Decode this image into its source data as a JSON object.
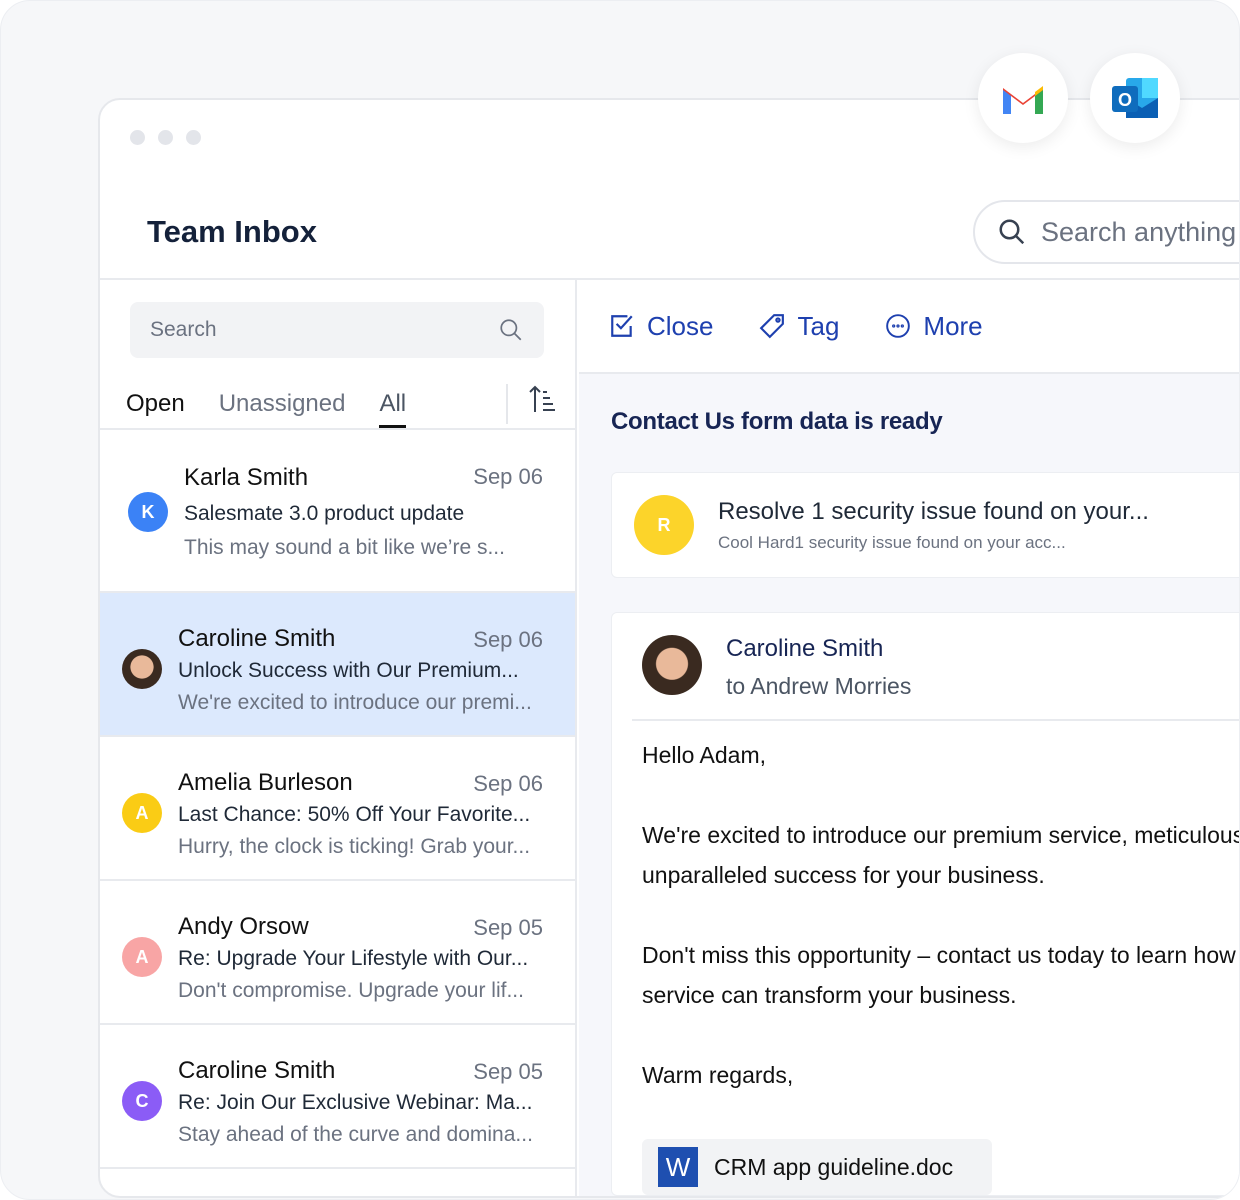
{
  "window": {
    "title": "Team Inbox"
  },
  "integrations": [
    {
      "name": "Gmail",
      "icon": "gmail-icon"
    },
    {
      "name": "Outlook",
      "icon": "outlook-icon"
    }
  ],
  "global_search": {
    "placeholder": "Search anything"
  },
  "inbox": {
    "search_placeholder": "Search",
    "tabs": [
      {
        "label": "Open"
      },
      {
        "label": "Unassigned"
      },
      {
        "label": "All",
        "selected": true
      }
    ],
    "items": [
      {
        "name": "Karla Smith",
        "date": "Sep 06",
        "subject": "Salesmate 3.0 product update",
        "preview": "This may sound a bit like we’re s...",
        "avatar": "K",
        "color": "#3b82f6"
      },
      {
        "name": "Caroline Smith",
        "date": "Sep 06",
        "subject": "Unlock Success with Our Premium...",
        "preview": "We're excited to introduce our premi...",
        "avatar": "photo",
        "selected": true
      },
      {
        "name": "Amelia Burleson",
        "date": "Sep 06",
        "subject": "Last Chance: 50% Off Your Favorite...",
        "preview": "Hurry, the clock is ticking! Grab your...",
        "avatar": "A",
        "color": "#facc15"
      },
      {
        "name": "Andy Orsow",
        "date": "Sep 05",
        "subject": "Re: Upgrade Your Lifestyle with Our...",
        "preview": "Don't compromise. Upgrade your lif...",
        "avatar": "A",
        "color": "#f8a5a5"
      },
      {
        "name": "Caroline Smith",
        "date": "Sep 05",
        "subject": "Re: Join Our Exclusive Webinar: Ma...",
        "preview": "Stay ahead of the curve and domina...",
        "avatar": "C",
        "color": "#8b5cf6"
      }
    ]
  },
  "toolbar": {
    "close": "Close",
    "tag": "Tag",
    "more": "More"
  },
  "conversation": {
    "title": "Contact Us form data is ready",
    "notice": {
      "avatar": "R",
      "title": "Resolve 1 security issue found on your...",
      "subtitle": "Cool Hard1 security issue found on your acc..."
    },
    "email": {
      "from": "Caroline Smith",
      "to": "to Andrew Morries",
      "body": [
        "Hello Adam,",
        "",
        "We're excited to introduce our premium service, meticulously",
        "unparalleled success for your business.",
        "",
        "Don't miss this opportunity – contact us today to learn how our",
        "service can transform your business.",
        "",
        "Warm regards,"
      ],
      "attachment": "CRM app guideline.doc"
    }
  }
}
